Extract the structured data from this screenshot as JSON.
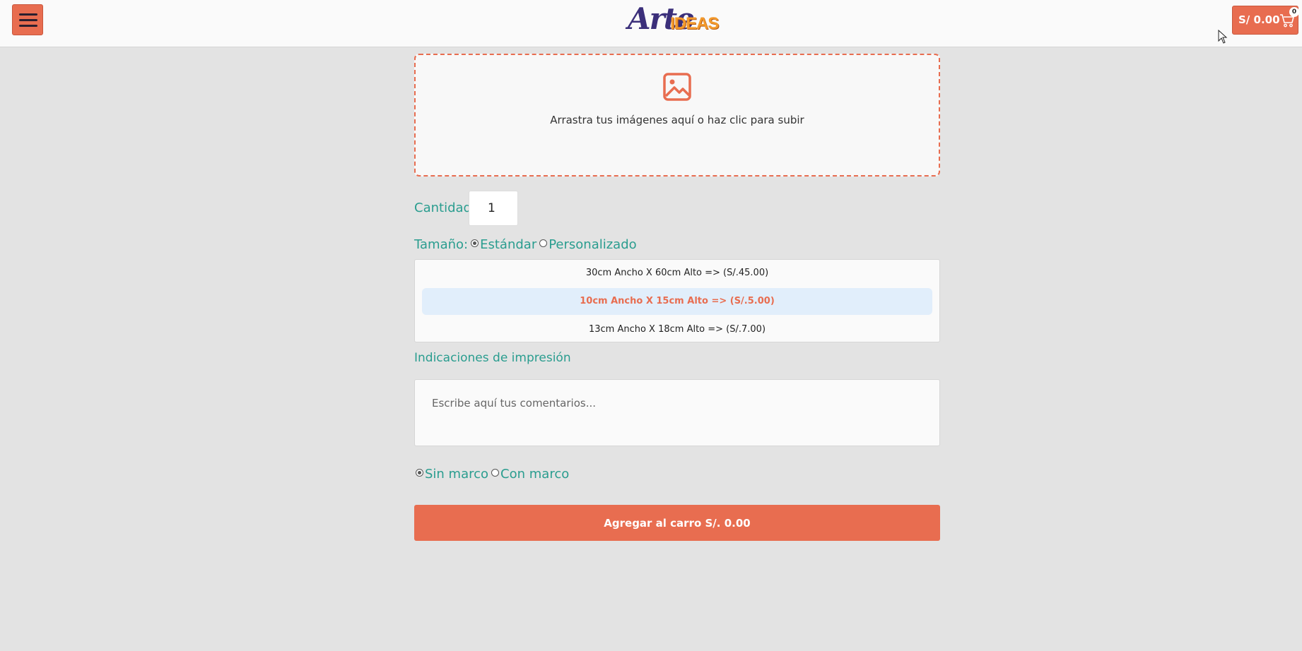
{
  "header": {
    "logo": {
      "script": "Arte",
      "accent": "IDEAS"
    },
    "cart": {
      "total": "S/ 0.00",
      "count": "0"
    }
  },
  "upload": {
    "text": "Arrastra tus imágenes aquí o haz clic para subir",
    "icon": "image-icon"
  },
  "quantity": {
    "label": "Cantidad",
    "value": "1"
  },
  "size": {
    "label": "Tamaño:",
    "options": [
      "Estándar",
      "Personalizado"
    ],
    "selected": "Estándar",
    "list": [
      "30cm Ancho X 60cm Alto => (S/.45.00)",
      "10cm Ancho X 15cm Alto => (S/.5.00)",
      "13cm Ancho X 18cm Alto => (S/.7.00)"
    ],
    "list_selected_index": 1
  },
  "comments": {
    "label": "Indicaciones de impresión",
    "placeholder": "Escribe aquí tus comentarios..."
  },
  "frame": {
    "options": [
      "Sin marco",
      "Con marco"
    ],
    "selected": "Sin marco"
  },
  "add_button": "Agregar al carro S/. 0.00",
  "colors": {
    "accent": "#e86d50",
    "label_green": "#2a9d8f",
    "selected_bg": "#e1eefb"
  }
}
